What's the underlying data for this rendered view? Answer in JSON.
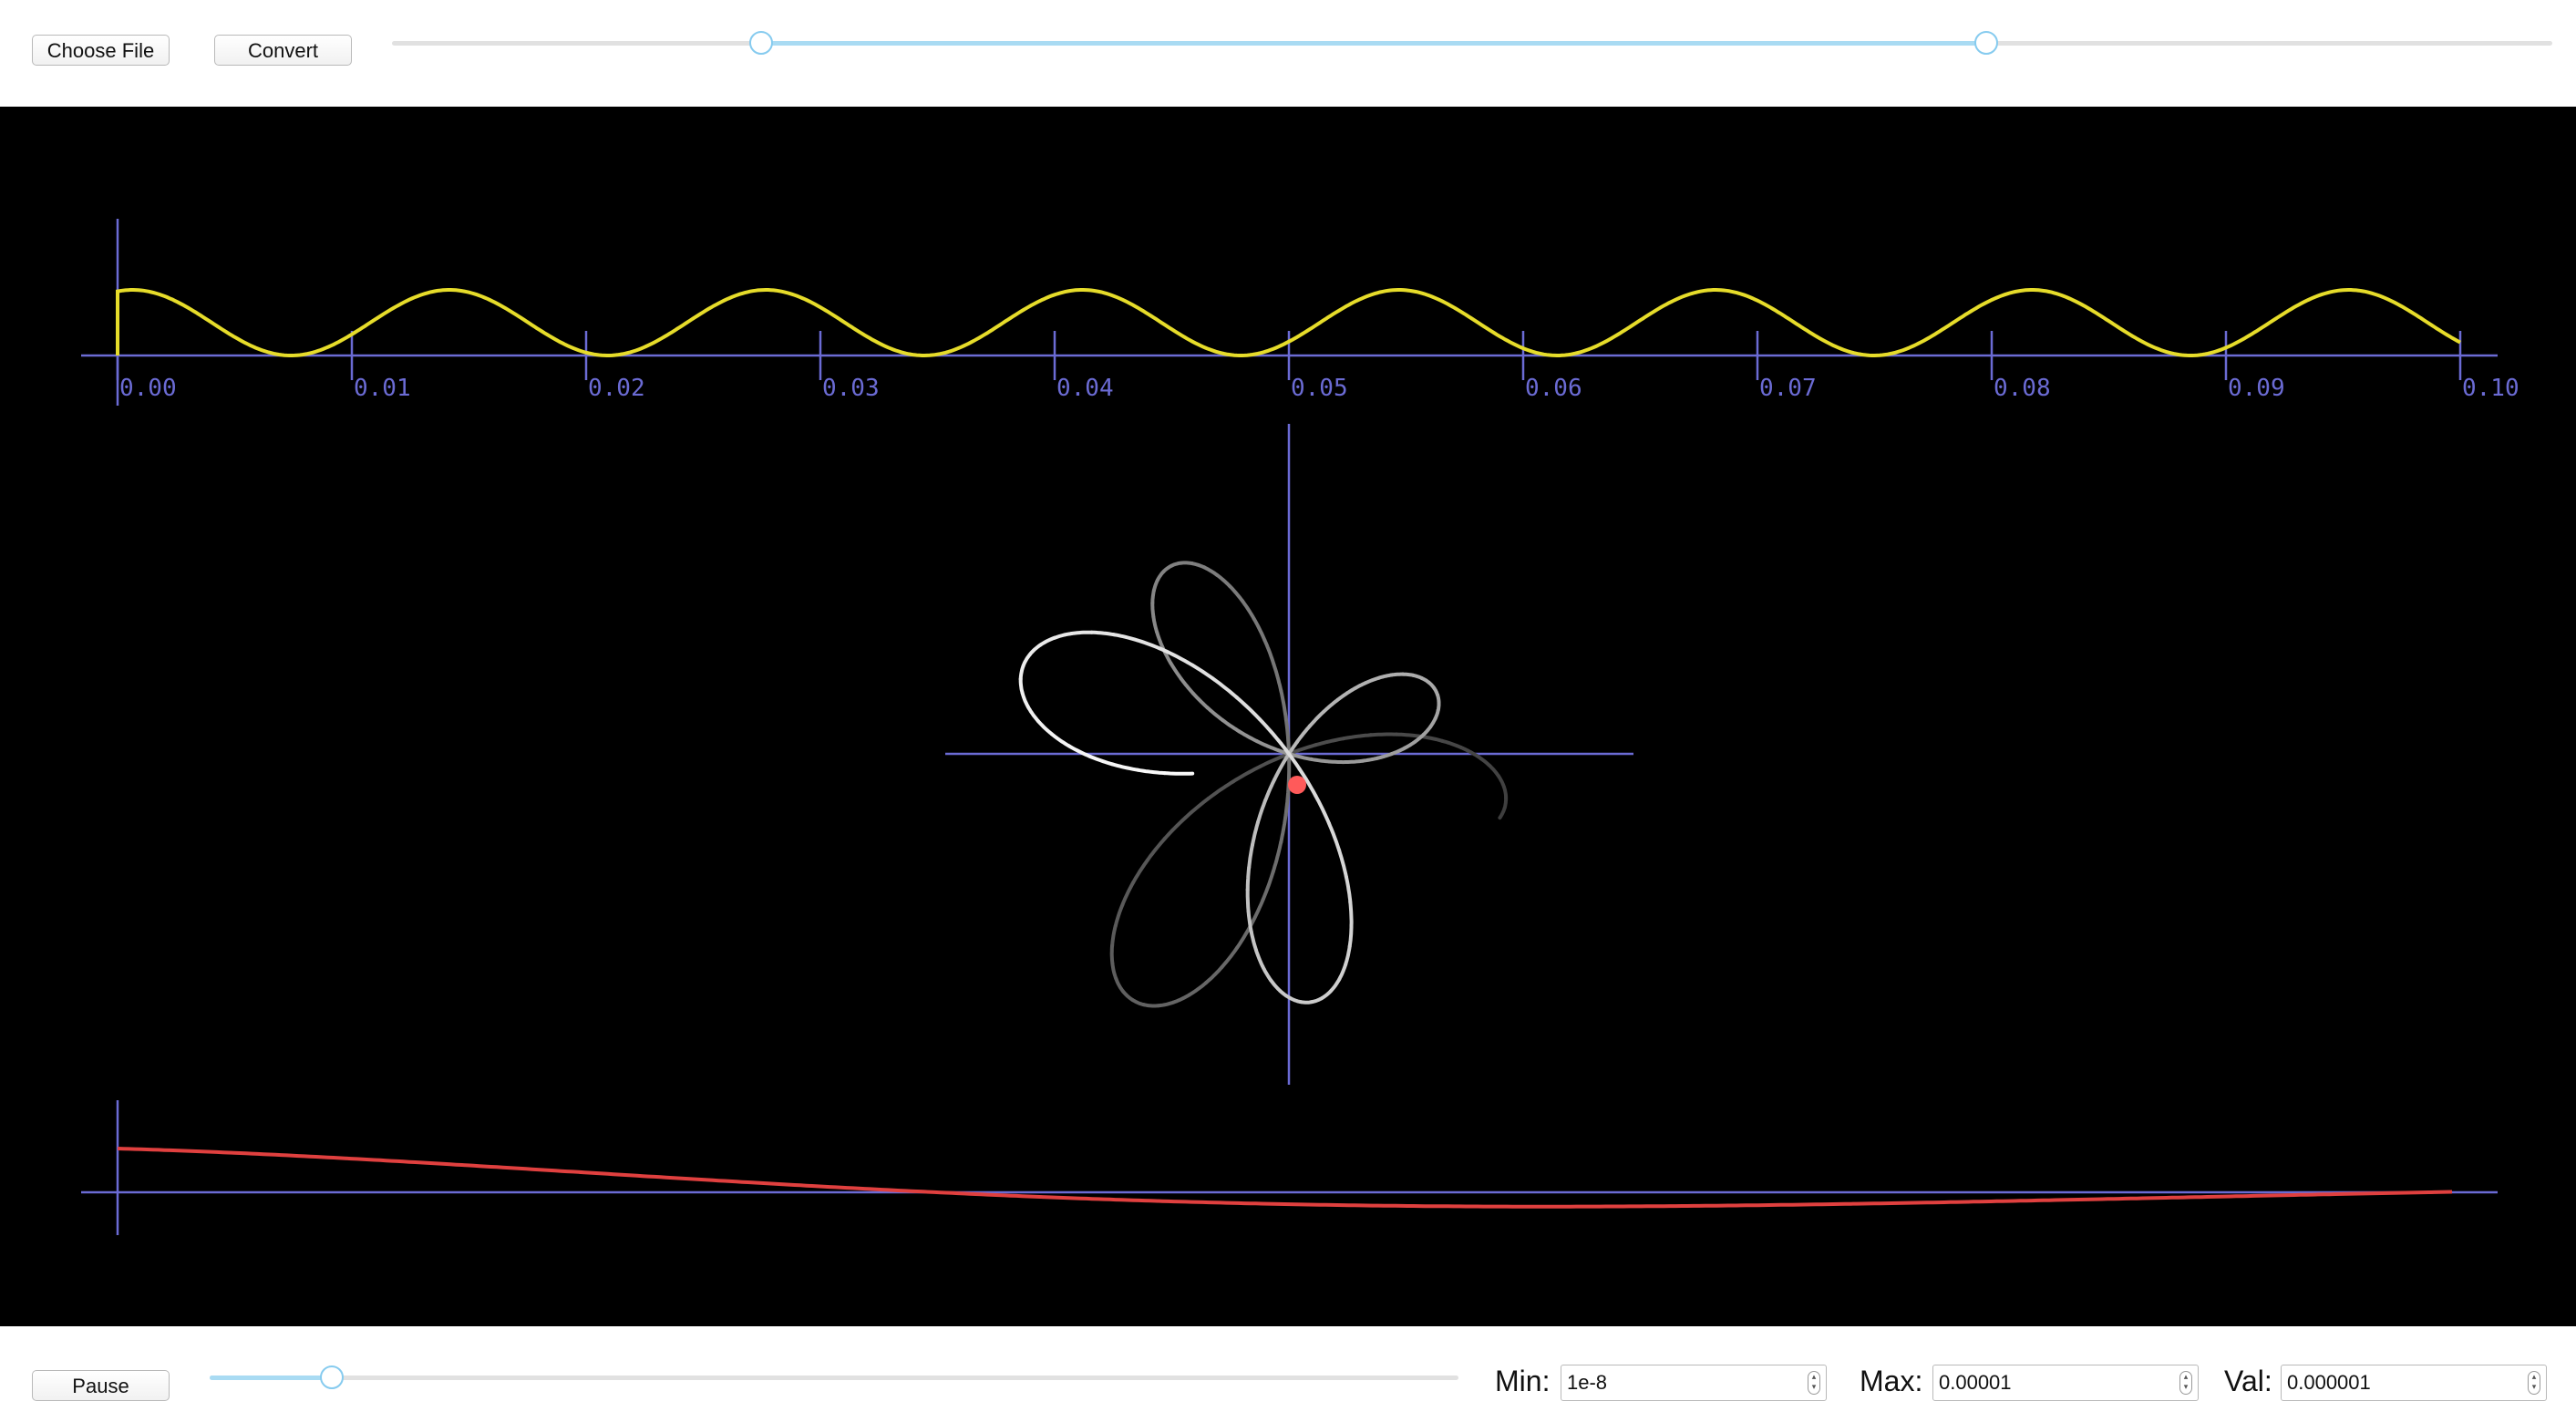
{
  "toolbar": {
    "choose_file_label": "Choose File",
    "convert_label": "Convert",
    "range_low_fraction": 0.171,
    "range_high_fraction": 0.738
  },
  "waveform": {
    "x_ticks": [
      "0.00",
      "0.01",
      "0.02",
      "0.03",
      "0.04",
      "0.05",
      "0.06",
      "0.07",
      "0.08",
      "0.09",
      "0.10"
    ],
    "x_range": [
      0,
      0.1
    ],
    "cycles": 7.4,
    "line_color": "#e6dc2a"
  },
  "phase_plot": {
    "petal_count": 5,
    "curve_color": "#e6e6e6",
    "marker_color": "#ff5a5a",
    "axis_color": "#6b6bd4"
  },
  "lower_trace": {
    "line_color": "#e0403f"
  },
  "controls": {
    "pause_label": "Pause",
    "playback_fraction": 0.098,
    "min_label": "Min:",
    "min_value": "1e-8",
    "max_label": "Max:",
    "max_value": "0.00001",
    "val_label": "Val:",
    "val_value": "0.000001"
  },
  "colors": {
    "background": "#000000",
    "axis": "#6b6bd4",
    "slider_fill": "#a9dbf3",
    "slider_knob": "#86cbef"
  }
}
